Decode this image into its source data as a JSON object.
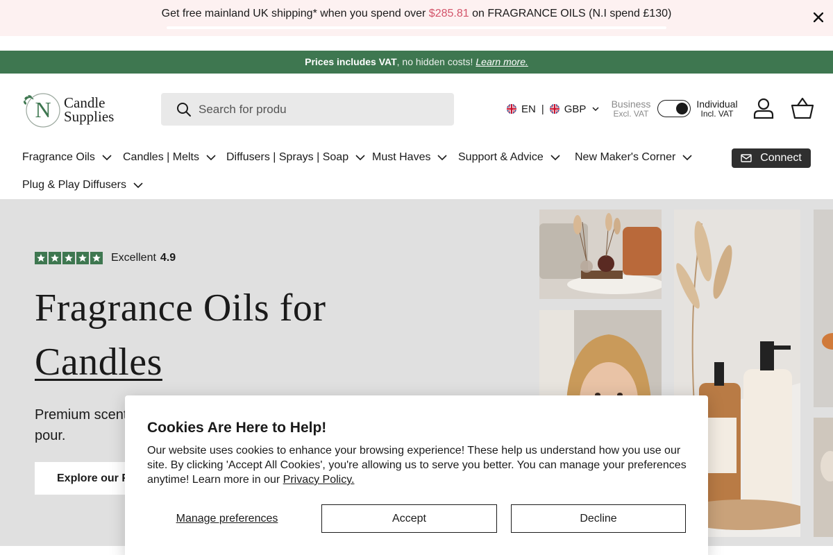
{
  "promo": {
    "text_before": "Get free mainland UK shipping* when you spend over ",
    "amount": "$285.81",
    "text_after": " on FRAGRANCE OILS (N.I spend £130)",
    "progress_fraction": 0.0,
    "close_icon": "close-icon"
  },
  "vat_bar": {
    "strong": "Prices includes VAT",
    "light": ", no hidden costs!",
    "link": "Learn more."
  },
  "header": {
    "logo_text_line1": "Candle",
    "logo_text_line2": "Supplies",
    "logo_letter": "N",
    "search_placeholder": "Search for produ",
    "language": "EN",
    "locale_separator": "|",
    "currency": "GBP",
    "business_label": "Business",
    "business_sub": "Excl. VAT",
    "individual_label": "Individual",
    "individual_sub": "Incl. VAT",
    "pricing_mode": "individual"
  },
  "nav": {
    "items": [
      {
        "label": "Fragrance Oils"
      },
      {
        "label": "Candles | Melts"
      },
      {
        "label": "Diffusers | Sprays | Soap"
      },
      {
        "label": "Must Haves"
      },
      {
        "label": "Support & Advice"
      },
      {
        "label": "New Maker's Corner"
      },
      {
        "label": "Plug & Play Diffusers"
      }
    ],
    "connect_label": "Connect"
  },
  "hero": {
    "rating_label": "Excellent",
    "rating_score": "4.9",
    "rating_stars": 5,
    "title_line1": "Fragrance Oils for",
    "title_line2": "Candles",
    "subtitle": "Premium scents,",
    "subtitle_line2": "pour.",
    "cta": "Explore our Fr"
  },
  "cookie": {
    "title": "Cookies Are Here to Help!",
    "body": "Our website uses cookies to enhance your browsing experience! These help us understand how you use our site. By clicking 'Accept All Cookies', you're allowing us to serve you better. You can manage your preferences anytime! Learn more in our ",
    "link": "Privacy Policy.",
    "manage": "Manage preferences",
    "accept": "Accept",
    "decline": "Decline"
  },
  "colors": {
    "brand_green": "#3e7750",
    "promo_bg": "#fdf1f1",
    "promo_amount": "#d3546a",
    "hero_bg": "#e0e0e0"
  }
}
